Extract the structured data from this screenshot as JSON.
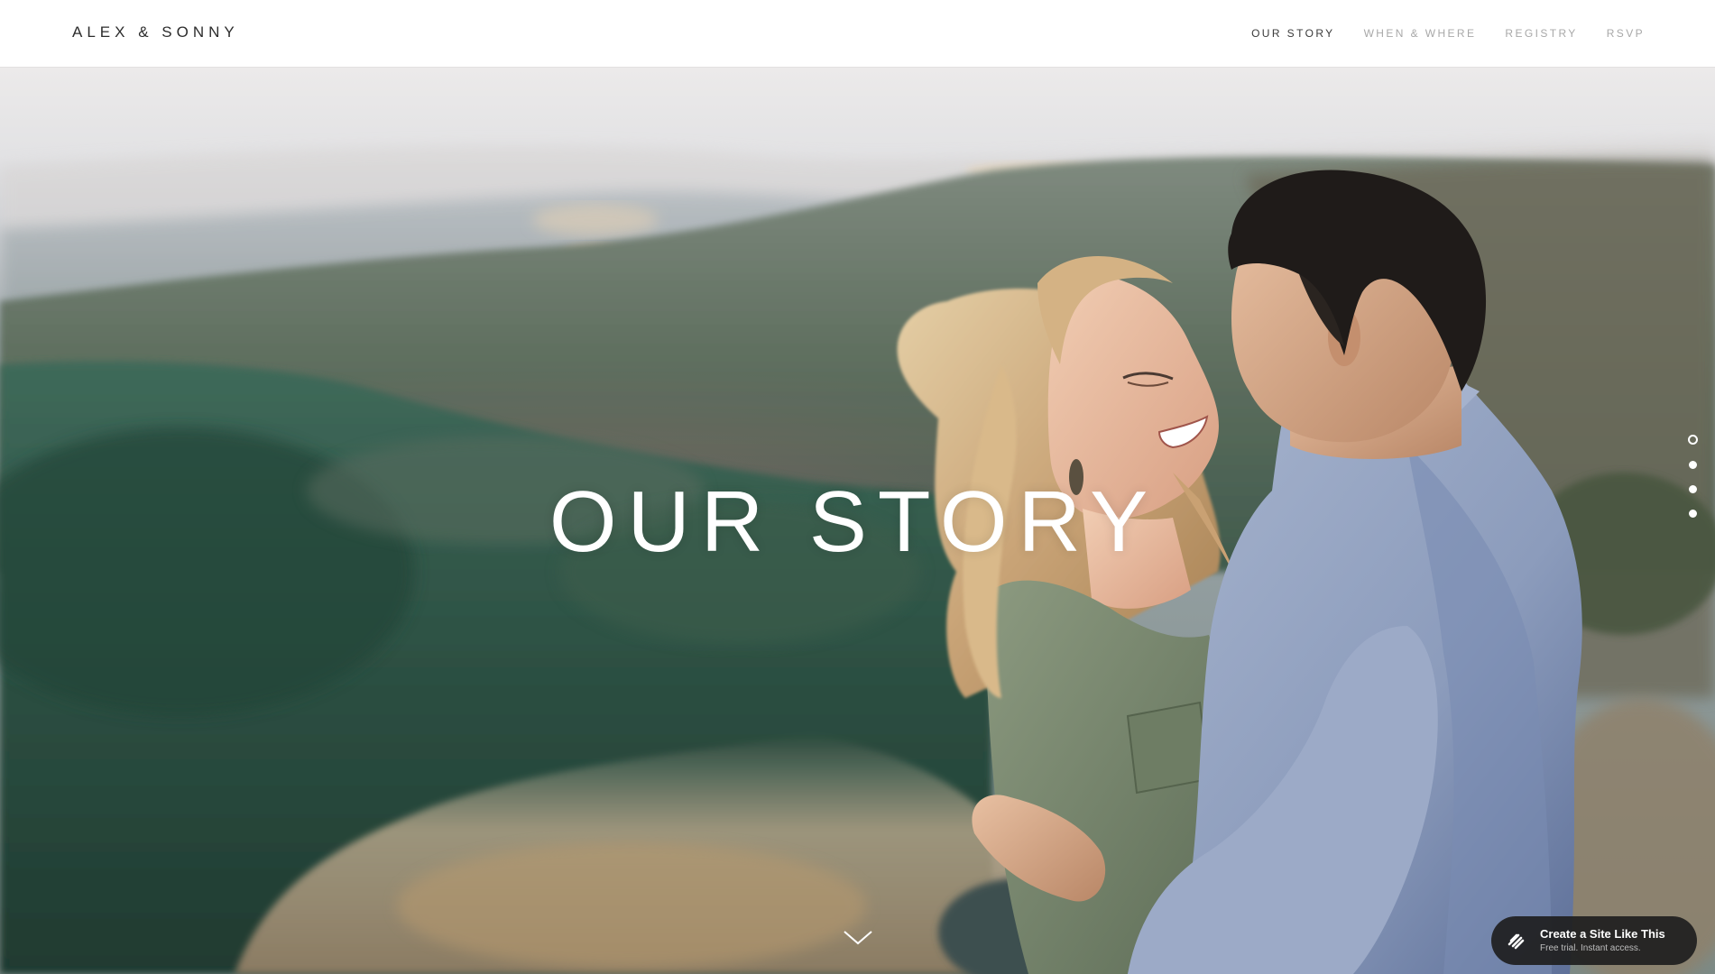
{
  "site": {
    "title": "ALEX & SONNY"
  },
  "nav": {
    "items": [
      {
        "label": "OUR STORY",
        "active": true
      },
      {
        "label": "WHEN & WHERE",
        "active": false
      },
      {
        "label": "REGISTRY",
        "active": false
      },
      {
        "label": "RSVP",
        "active": false
      }
    ]
  },
  "hero": {
    "title": "OUR STORY",
    "scroll_icon": "chevron-down-icon"
  },
  "section_dots": {
    "count": 4,
    "active_index": 0
  },
  "badge": {
    "title": "Create a Site Like This",
    "subtitle": "Free trial. Instant access.",
    "icon": "squarespace-logo-icon"
  },
  "colors": {
    "header_bg": "#ffffff",
    "nav_active": "#3a3a3a",
    "nav_inactive": "#a8a8a8",
    "hero_text": "#ffffff",
    "badge_bg": "#1e1e1e"
  }
}
